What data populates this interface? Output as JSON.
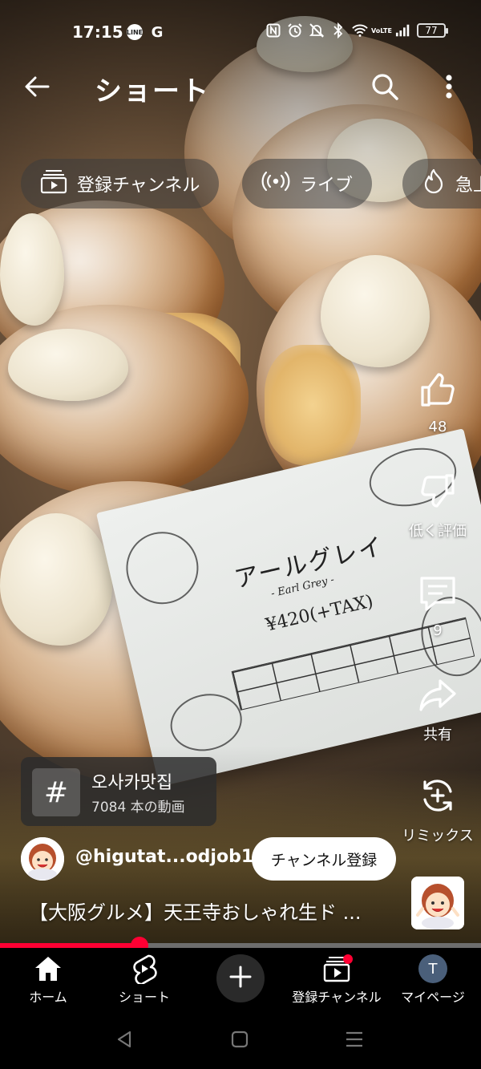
{
  "status_bar": {
    "time": "17:15",
    "app_icons": [
      "line-icon",
      "google-icon"
    ],
    "system_icons": [
      "nfc-icon",
      "alarm-icon",
      "mute-icon",
      "bluetooth-icon",
      "wifi-icon",
      "volte-icon",
      "signal-icon"
    ],
    "battery": "77"
  },
  "top_bar": {
    "title": "ショート",
    "back_icon": "arrow-left-icon",
    "search_icon": "search-icon",
    "more_icon": "more-vertical-icon"
  },
  "chips": [
    {
      "label": "登録チャンネル",
      "icon": "subscriptions-icon"
    },
    {
      "label": "ライブ",
      "icon": "live-icon"
    },
    {
      "label": "急上",
      "icon": "trending-icon"
    }
  ],
  "rail": {
    "like_count": "48",
    "dislike_label": "低く評価",
    "comment_count": "9",
    "share_label": "共有",
    "remix_label": "リミックス"
  },
  "video_text": {
    "card_title": "アールグレイ",
    "card_subtitle": "- Earl Grey -",
    "card_price": "¥420(+TAX)"
  },
  "hashtag": {
    "name": "오사카맛집",
    "count": "7084 本の動画"
  },
  "channel": {
    "handle": "@higutat...odjob19",
    "subscribe_label": "チャンネル登録"
  },
  "video_title": "【大阪グルメ】天王寺おしゃれ生ド ...",
  "progress": {
    "fraction": 0.29
  },
  "bottom_nav": [
    {
      "label": "ホーム",
      "icon": "home-icon"
    },
    {
      "label": "ショート",
      "icon": "shorts-icon"
    },
    {
      "label": "",
      "icon": "plus-icon"
    },
    {
      "label": "登録チャンネル",
      "icon": "subscriptions-icon"
    },
    {
      "label": "マイページ",
      "icon": "profile-avatar",
      "avatar_letter": "T"
    }
  ],
  "colors": {
    "accent": "#ff0033",
    "avatar_bg": "#4a5f7a",
    "chip_bg": "#3c3c3c"
  }
}
